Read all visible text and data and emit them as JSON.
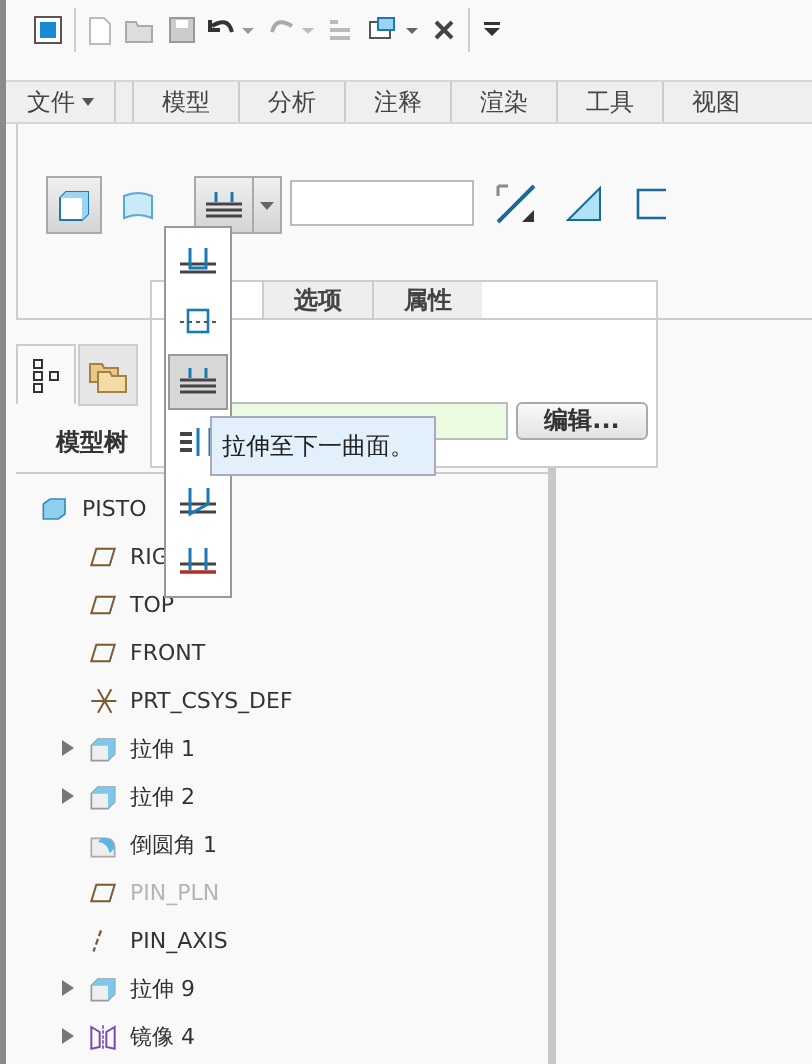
{
  "ribbon": {
    "file_menu": "文件",
    "tabs": [
      {
        "label": "模型"
      },
      {
        "label": "分析"
      },
      {
        "label": "注释"
      },
      {
        "label": "渲染"
      },
      {
        "label": "工具"
      },
      {
        "label": "视图"
      }
    ]
  },
  "dashboard": {
    "body_types": [
      {
        "kind": "solid",
        "selected": true
      },
      {
        "kind": "surface",
        "selected": false
      }
    ],
    "depth_menu": [
      {
        "kind": "blind",
        "selected": false
      },
      {
        "kind": "symmetric",
        "selected": false
      },
      {
        "kind": "next",
        "selected": true
      },
      {
        "kind": "through_all",
        "selected": false
      },
      {
        "kind": "until",
        "selected": false
      },
      {
        "kind": "to_selected",
        "selected": false
      }
    ],
    "tooltip": "拉伸至下一曲面。"
  },
  "panel": {
    "tabs": [
      {
        "label": "选项",
        "selected": false
      },
      {
        "label": "属性",
        "selected": false
      }
    ],
    "edit_button": "编辑..."
  },
  "tree_panel": {
    "tabs": [
      {
        "kind": "tree",
        "selected": true
      },
      {
        "kind": "folder",
        "selected": false
      }
    ],
    "label": "模型树",
    "items": [
      {
        "kind": "part",
        "label": "PISTO",
        "expandable": false,
        "disabled": false,
        "children": [
          {
            "kind": "plane",
            "label": "RIG",
            "expandable": false,
            "disabled": false
          },
          {
            "kind": "plane",
            "label": "TOP",
            "expandable": false,
            "disabled": false
          },
          {
            "kind": "plane",
            "label": "FRONT",
            "expandable": false,
            "disabled": false
          },
          {
            "kind": "csys",
            "label": "PRT_CSYS_DEF",
            "expandable": false,
            "disabled": false
          },
          {
            "kind": "extrude",
            "label": "拉伸 1",
            "expandable": true,
            "disabled": false
          },
          {
            "kind": "extrude",
            "label": "拉伸 2",
            "expandable": true,
            "disabled": false
          },
          {
            "kind": "round",
            "label": "倒圆角 1",
            "expandable": false,
            "disabled": false
          },
          {
            "kind": "plane",
            "label": "PIN_PLN",
            "expandable": false,
            "disabled": true
          },
          {
            "kind": "axis",
            "label": "PIN_AXIS",
            "expandable": false,
            "disabled": false
          },
          {
            "kind": "extrude",
            "label": "拉伸 9",
            "expandable": true,
            "disabled": false
          },
          {
            "kind": "mirror",
            "label": "镜像 4",
            "expandable": true,
            "disabled": false
          }
        ]
      }
    ]
  }
}
